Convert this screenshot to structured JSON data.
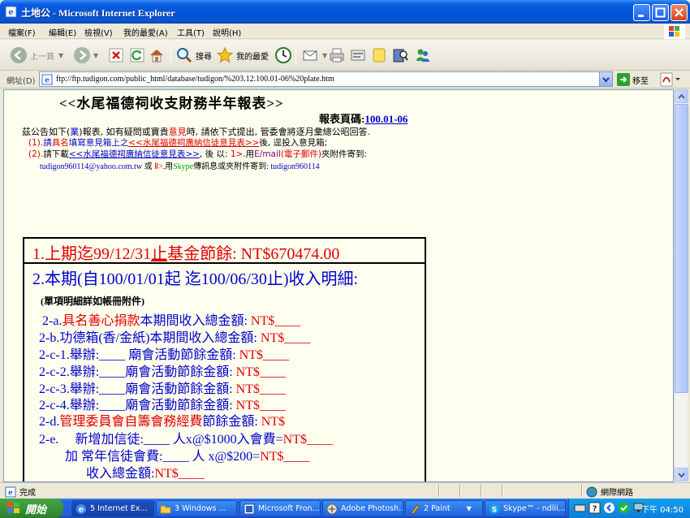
{
  "window": {
    "title": "土地公 - Microsoft Internet Explorer"
  },
  "menubar": {
    "items": [
      "檔案(F)",
      "編輯(E)",
      "檢視(V)",
      "我的最愛(A)",
      "工具(T)",
      "說明(H)"
    ]
  },
  "toolbar": {
    "back_label": "上一頁",
    "search_label": "搜尋",
    "favorites_label": "我的最愛"
  },
  "address": {
    "label": "網址(D)",
    "url": "ftp://ftp.tudigon.com/public_html/database/tudigon/%203.12.100.01-06%20plate.htm",
    "go_label": "移至"
  },
  "page": {
    "title": "<<水尾福德祠收支財務半年報表>>",
    "code_label": "報表頁碼:",
    "code_value": "100.01-06",
    "notice": {
      "a": "茲公告如下(",
      "b": "業",
      "c": ")報表, 如有疑問或寶貴",
      "d": "意見",
      "e": "時, 請依下式提出, 管委會將逐月彙總公昭回答."
    },
    "line1": {
      "num": "(1).",
      "a": "請",
      "b": "具名",
      "c": "填寫意見箱上之",
      "d": "<<水尾福德祠廣納信徒意見表>>",
      "e": "後, 逕投入意見箱;"
    },
    "line2": {
      "num": "(2).",
      "a": "請下載",
      "b": "<<水尾福德祠廣納信徒意見表>>",
      "c": ", 後 以: ",
      "d": "1>",
      "e": ".用",
      "f": "E/mail",
      "g": "(電子郵件)",
      "h": "夾附件寄到:"
    },
    "line3": {
      "a": "tudigon960114@yahoo.com.tw",
      "b": " 或 ",
      "c": "Ⅱ>",
      "d": ".用",
      "e": "Skype",
      "f": "傳訊息或夾附件寄到: ",
      "g": "tudigon960114"
    },
    "section1": {
      "num": "1.",
      "a": "上期迄99/12/31",
      "b": "止",
      "c": "基金節餘: NT$670474.00"
    },
    "section2": {
      "title": "2.本期(自100/01/01起 迄100/06/30止)收入明細:",
      "note": "(單項明細詳如帳冊附件)",
      "rows": [
        {
          "a": "2-a.",
          "b": "具名善心捐款",
          "c": "本期間收入總金額: ",
          "d": "NT$____"
        },
        {
          "a": "2-b.功德箱(香/金紙)本期間收入總金額: ",
          "b": "",
          "c": "",
          "d": "NT$____"
        },
        {
          "a": "2-c-1.舉辦:____ 廟會活動節餘金額: ",
          "b": "",
          "c": "",
          "d": "NT$____"
        },
        {
          "a": "2-c-2.舉辦:____廟會活動節餘金額: ",
          "b": "",
          "c": "",
          "d": "NT$____"
        },
        {
          "a": "2-c-3.舉辦:____廟會活動節餘金額: ",
          "b": "",
          "c": "",
          "d": "NT$____"
        },
        {
          "a": "2-c-4.舉辦:____廟會活動節餘金額: ",
          "b": "",
          "c": "",
          "d": "NT$____"
        },
        {
          "a": "2-d.",
          "b": "管理委員會自籌會務經費",
          "c": "節餘金額: ",
          "d": "NT$"
        }
      ],
      "e1": {
        "a": "2-e.",
        "b": "新增加信徒:____ 人x@$1000入會費=",
        "c": "NT$____"
      },
      "e2": {
        "a": "加 常年信徒會費:____ 人 x@$200=",
        "b": "NT$____"
      },
      "e3": {
        "a": "收入總金額:",
        "b": "NT$____"
      }
    }
  },
  "statusbar": {
    "left": "完成",
    "right": "網際網路"
  },
  "taskbar": {
    "start": "開始",
    "tasks": [
      "5 Internet Ex...",
      "3 Windows ...",
      "Microsoft Fron...",
      "Adobe Photosh...",
      "2 Paint",
      "Skype™ - ndlii..."
    ],
    "clock": "下午 04:50"
  }
}
